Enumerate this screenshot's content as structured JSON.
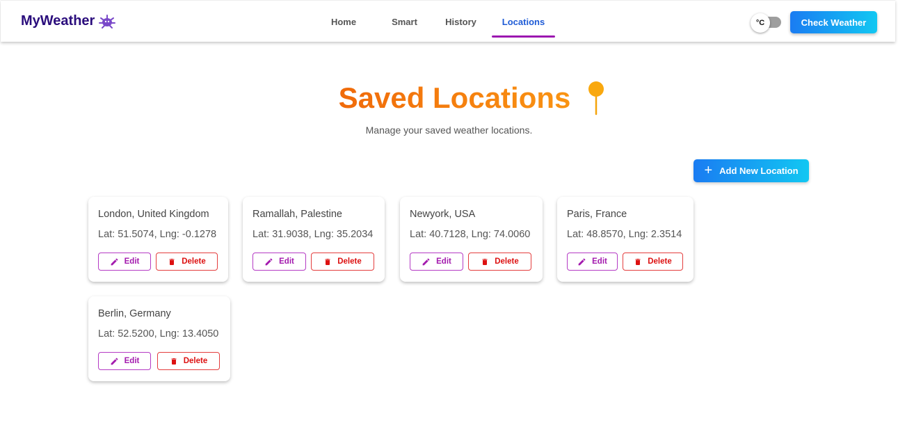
{
  "header": {
    "brand": "MyWeather",
    "nav": [
      "Home",
      "Smart",
      "History",
      "Locations"
    ],
    "active_nav": "Locations",
    "unit_toggle_label": "°C",
    "check_weather_label": "Check Weather"
  },
  "page": {
    "title": "Saved Locations",
    "subtitle": "Manage your saved weather locations.",
    "add_button_label": "Add New Location"
  },
  "locations": [
    {
      "name": "London, United Kingdom",
      "coords": "Lat: 51.5074, Lng: -0.1278"
    },
    {
      "name": "Ramallah, Palestine",
      "coords": "Lat: 31.9038, Lng: 35.2034"
    },
    {
      "name": "Newyork, USA",
      "coords": "Lat: 40.7128, Lng: 74.0060"
    },
    {
      "name": "Paris, France",
      "coords": "Lat: 48.8570, Lng: 2.3514"
    },
    {
      "name": "Berlin, Germany",
      "coords": "Lat: 52.5200, Lng: 13.4050"
    }
  ],
  "card_actions": {
    "edit_label": "Edit",
    "delete_label": "Delete"
  },
  "colors": {
    "brand": "#2a0d7c",
    "active_nav": "#1e5bd6",
    "nav_underline": "#9c17b0",
    "title_orange": "#f57f0c",
    "edit": "#a31aae",
    "delete": "#dd1111",
    "primary_button": "#1a7cf2"
  },
  "icons": {
    "brand": "weather-mascot-icon",
    "title": "map-pin-icon",
    "add": "plus-icon",
    "edit": "pencil-icon",
    "delete": "trash-icon"
  }
}
